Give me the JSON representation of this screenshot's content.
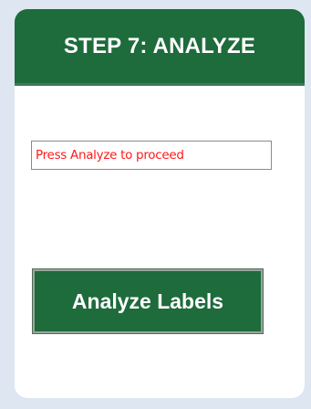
{
  "header": {
    "title": "STEP 7: ANALYZE"
  },
  "status": {
    "message": "Press Analyze to proceed"
  },
  "actions": {
    "analyze_label": "Analyze Labels"
  },
  "colors": {
    "header_bg": "#1e6b3c",
    "button_bg": "#1e6b3c",
    "status_text": "#ff1a1a",
    "page_bg": "#dde6f1"
  }
}
